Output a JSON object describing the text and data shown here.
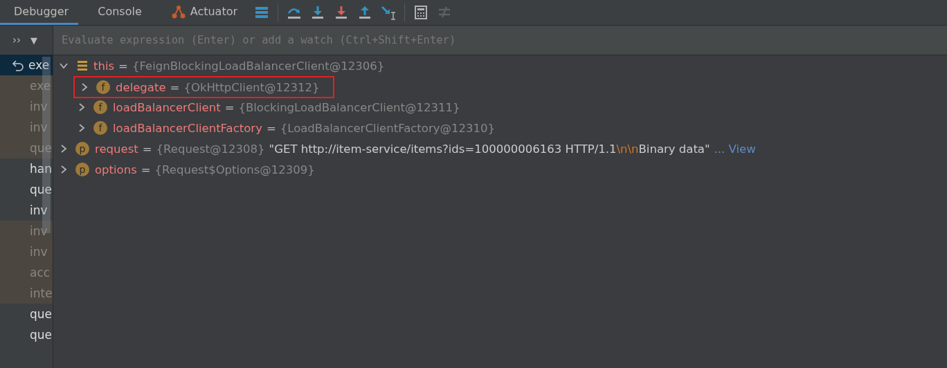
{
  "tabs": [
    {
      "label": "Debugger",
      "selected": true,
      "kind": "text"
    },
    {
      "label": "Console",
      "selected": false,
      "kind": "text"
    },
    {
      "label": "Actuator",
      "selected": false,
      "kind": "actuator"
    }
  ],
  "toolbar": [
    {
      "kind": "frames"
    },
    {
      "kind": "sep"
    },
    {
      "kind": "step-over"
    },
    {
      "kind": "step-into"
    },
    {
      "kind": "force-step-into"
    },
    {
      "kind": "step-out"
    },
    {
      "kind": "run-to-cursor"
    },
    {
      "kind": "sep"
    },
    {
      "kind": "evaluate"
    },
    {
      "kind": "trace",
      "disabled": true
    }
  ],
  "frames_header": {
    "more": "››",
    "menu": "▼"
  },
  "evaluate": {
    "placeholder": "Evaluate expression (Enter) or add a watch (Ctrl+Shift+Enter)"
  },
  "frames": [
    {
      "name": "exe",
      "selected": true,
      "library": false,
      "current": true
    },
    {
      "name": "exe",
      "selected": false,
      "library": true
    },
    {
      "name": "inv",
      "selected": false,
      "library": true
    },
    {
      "name": "inv",
      "selected": false,
      "library": true
    },
    {
      "name": "que",
      "selected": false,
      "library": true
    },
    {
      "name": "han",
      "selected": false,
      "library": false
    },
    {
      "name": "que",
      "selected": false,
      "library": false
    },
    {
      "name": "inv",
      "selected": false,
      "library": false
    },
    {
      "name": "inv",
      "selected": false,
      "library": true
    },
    {
      "name": "inv",
      "selected": false,
      "library": true
    },
    {
      "name": "acc",
      "selected": false,
      "library": true
    },
    {
      "name": "inte",
      "selected": false,
      "library": true
    },
    {
      "name": "que",
      "selected": false,
      "library": false
    },
    {
      "name": "que",
      "selected": false,
      "library": false
    }
  ],
  "variables": [
    {
      "kind": "object",
      "name": "this",
      "separator": "=",
      "value": "{FeignBlockingLoadBalancerClient@12306}",
      "expanded": true,
      "children": [
        {
          "kind": "field",
          "badge": "f",
          "name": "delegate",
          "separator": "=",
          "value": "{OkHttpClient@12312}",
          "expanded": false,
          "highlighted": true
        },
        {
          "kind": "field",
          "badge": "f",
          "name": "loadBalancerClient",
          "separator": "=",
          "value": "{BlockingLoadBalancerClient@12311}",
          "expanded": false
        },
        {
          "kind": "field",
          "badge": "f",
          "name": "loadBalancerClientFactory",
          "separator": "=",
          "value": "{LoadBalancerClientFactory@12310}",
          "expanded": false
        }
      ]
    },
    {
      "kind": "param",
      "badge": "p",
      "name": "request",
      "separator": "=",
      "value": "{Request@12308}",
      "string_parts": [
        {
          "text": "\"GET http://item-service/items?ids=100000006163 HTTP/1.1",
          "escape": false
        },
        {
          "text": "\\n\\n",
          "escape": true
        },
        {
          "text": "Binary data\"",
          "escape": false
        }
      ],
      "link": "... View",
      "expanded": false
    },
    {
      "kind": "param",
      "badge": "p",
      "name": "options",
      "separator": "=",
      "value": "{Request$Options@12309}",
      "expanded": false
    }
  ]
}
